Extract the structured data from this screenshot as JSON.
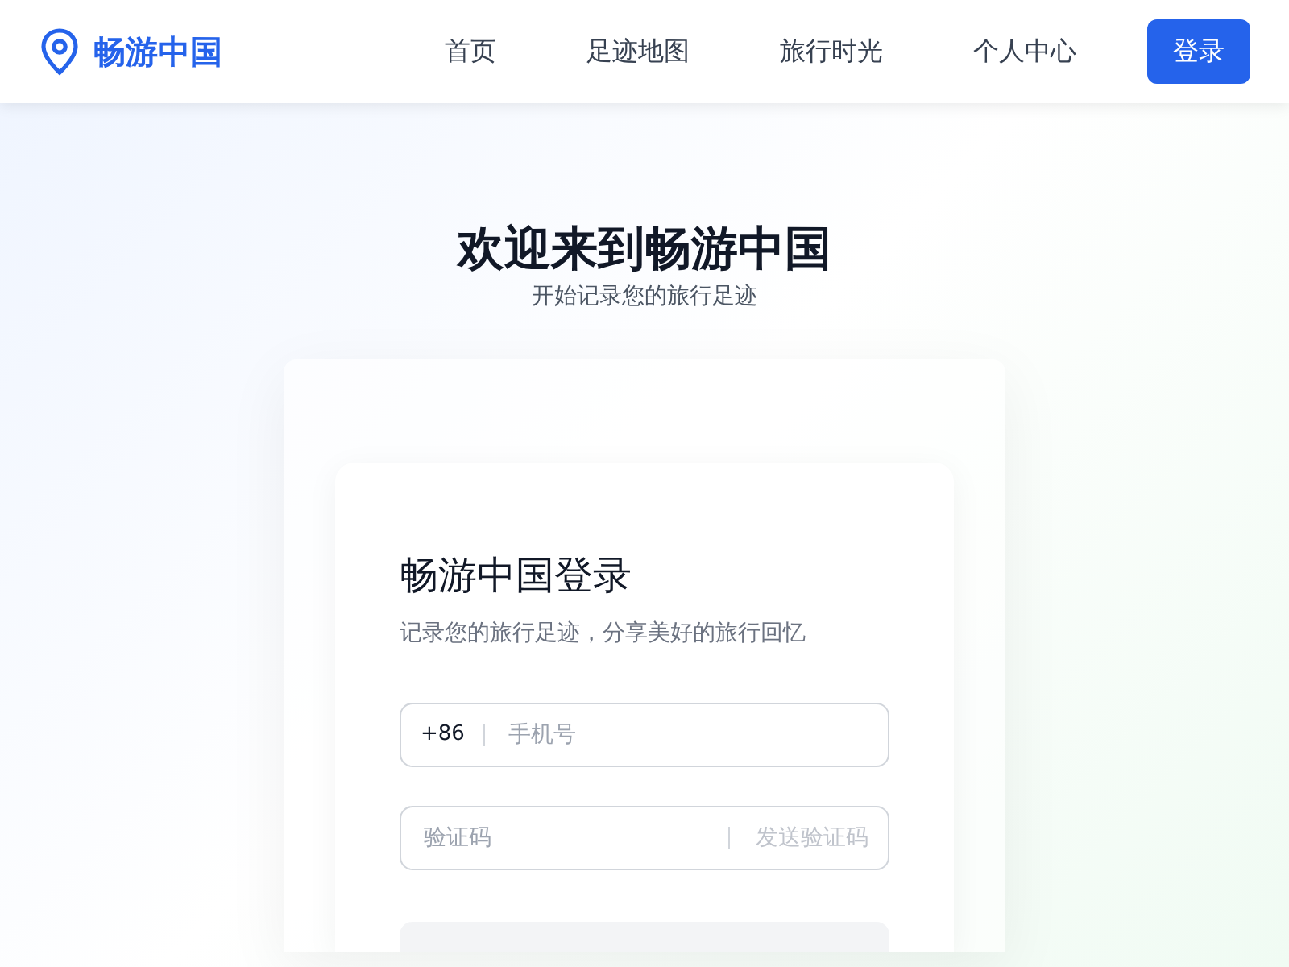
{
  "brand": {
    "name": "畅游中国"
  },
  "nav": {
    "items": [
      {
        "label": "首页"
      },
      {
        "label": "足迹地图"
      },
      {
        "label": "旅行时光"
      },
      {
        "label": "个人中心"
      }
    ],
    "login_button": "登录"
  },
  "hero": {
    "title": "欢迎来到畅游中国",
    "subtitle": "开始记录您的旅行足迹"
  },
  "login_form": {
    "title": "畅游中国登录",
    "subtitle": "记录您的旅行足迹，分享美好的旅行回忆",
    "phone": {
      "prefix": "+86",
      "placeholder": "手机号"
    },
    "code": {
      "placeholder": "验证码",
      "send_button": "发送验证码",
      "send_disabled": true
    },
    "submit": {
      "disabled": true
    }
  }
}
